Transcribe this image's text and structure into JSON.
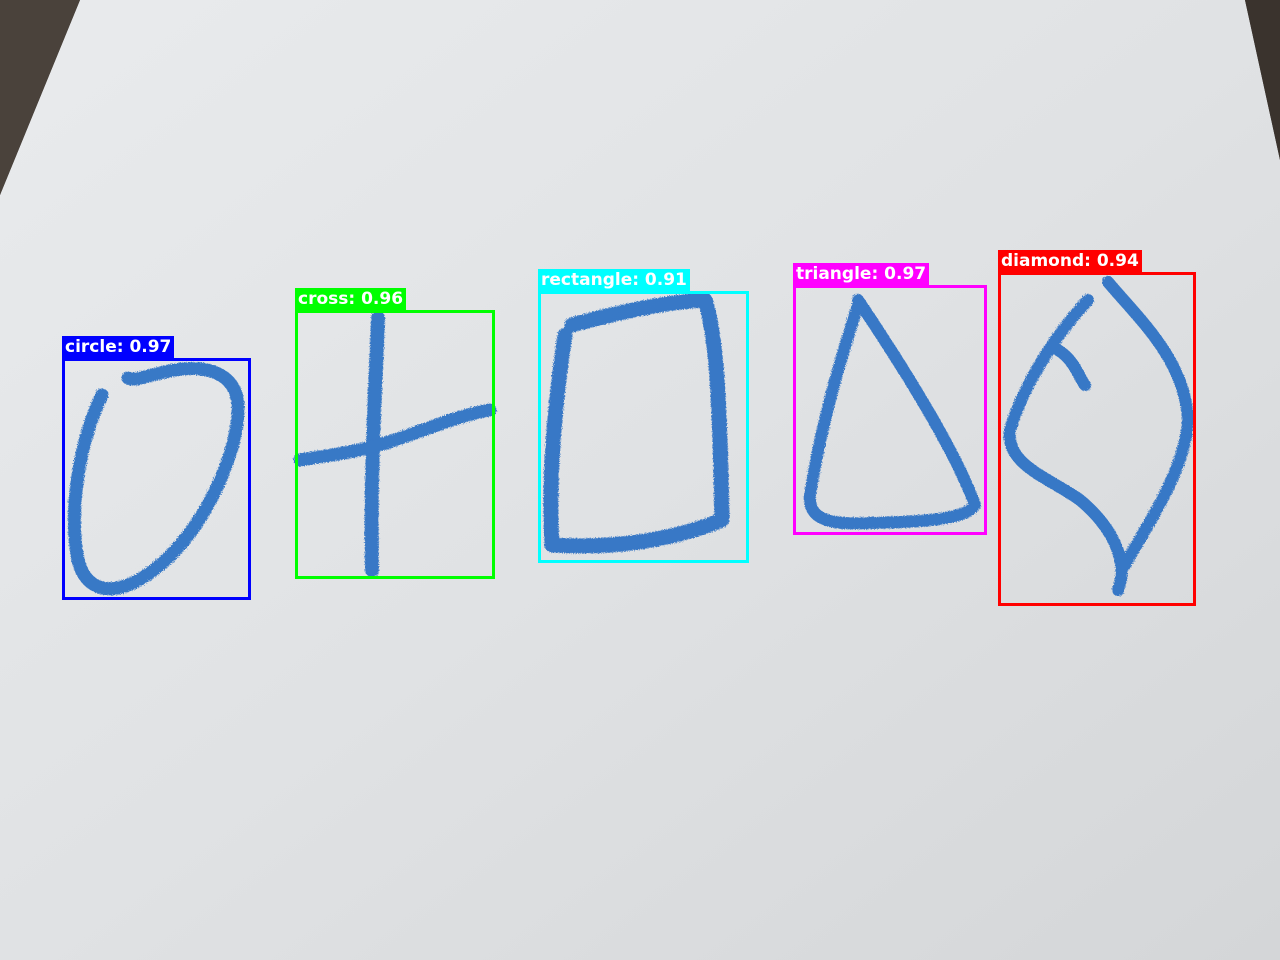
{
  "colors": {
    "paper": "#e4e6e8",
    "background": "#2f2a26",
    "crayon": "#2a6fc4"
  },
  "detections": [
    {
      "class": "circle",
      "score_text": "0.97",
      "label": "circle: 0.97",
      "color": "#0000ff"
    },
    {
      "class": "cross",
      "score_text": "0.96",
      "label": "cross: 0.96",
      "color": "#00ff00"
    },
    {
      "class": "rectangle",
      "score_text": "0.91",
      "label": "rectangle: 0.91",
      "color": "#00ffff"
    },
    {
      "class": "triangle",
      "score_text": "0.97",
      "label": "triangle: 0.97",
      "color": "#ff00ff"
    },
    {
      "class": "diamond",
      "score_text": "0.94",
      "label": "diamond: 0.94",
      "color": "#ff0000"
    }
  ]
}
